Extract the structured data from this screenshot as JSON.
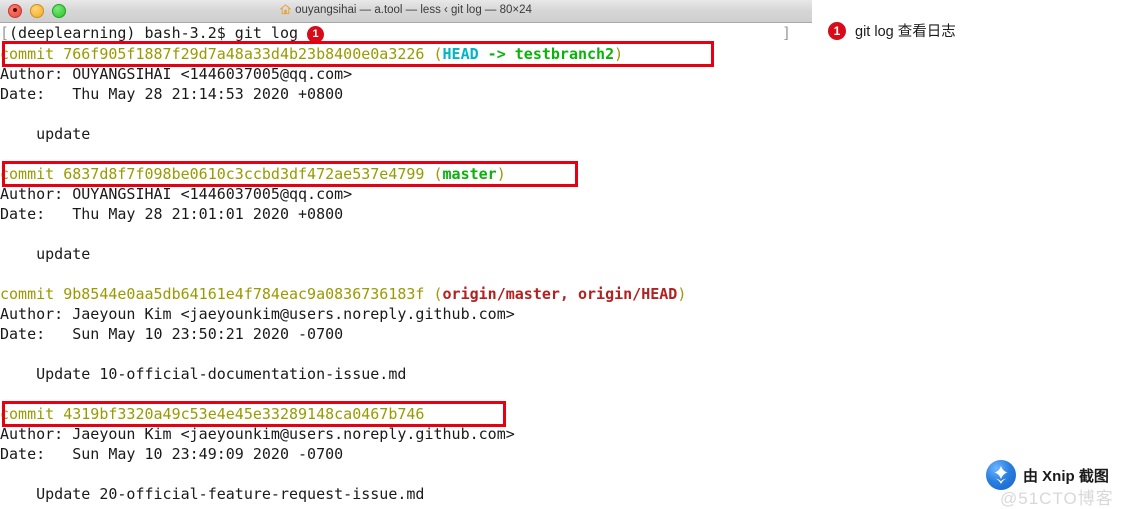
{
  "window": {
    "title": "ouyangsihai — a.tool — less ‹ git log — 80×24",
    "home_icon": "home-icon",
    "controls": {
      "close": "close",
      "minimize": "minimize",
      "maximize": "maximize"
    }
  },
  "terminal": {
    "prompt": {
      "lead_bracket": "[",
      "text": "(deeplearning) bash-3.2$ git log ",
      "badge": "1",
      "trailing_bracket": "]"
    },
    "commits": [
      {
        "keyword": "commit ",
        "hash": "766f905f1887f29d7a48a33d4b23b8400e0a3226",
        "refs_open": " (",
        "ref_head": "HEAD",
        "ref_arrow": " -> ",
        "ref_branch": "testbranch2",
        "refs_close": ")",
        "author": "Author: OUYANGSIHAI <1446037005@qq.com>",
        "date": "Date:   Thu May 28 21:14:53 2020 +0800",
        "message": "    update",
        "boxed": true
      },
      {
        "keyword": "commit ",
        "hash": "6837d8f7f098be0610c3ccbd3df472ae537e4799",
        "refs_open": " (",
        "ref_branch": "master",
        "refs_close": ")",
        "author": "Author: OUYANGSIHAI <1446037005@qq.com>",
        "date": "Date:   Thu May 28 21:01:01 2020 +0800",
        "message": "    update",
        "boxed": true
      },
      {
        "keyword": "commit ",
        "hash": "9b8544e0aa5db64161e4f784eac9a0836736183f",
        "refs_open": " (",
        "ref_remote": "origin/master, origin/HEAD",
        "refs_close": ")",
        "author": "Author: Jaeyoun Kim <jaeyounkim@users.noreply.github.com>",
        "date": "Date:   Sun May 10 23:50:21 2020 -0700",
        "message": "    Update 10-official-documentation-issue.md",
        "boxed": false
      },
      {
        "keyword": "commit ",
        "hash": "4319bf3320a49c53e4e45e33289148ca0467b746",
        "author": "Author: Jaeyoun Kim <jaeyounkim@users.noreply.github.com>",
        "date": "Date:   Sun May 10 23:49:09 2020 -0700",
        "message": "    Update 20-official-feature-request-issue.md",
        "boxed": true
      }
    ]
  },
  "annotation": {
    "badge": "1",
    "text": "git log 查看日志"
  },
  "watermark": {
    "xnip_text": "由 Xnip 截图",
    "cto_text": "@51CTO博客"
  },
  "colors": {
    "annotation_red": "#e60012",
    "badge_red": "#d80c18",
    "commit_yellow": "#9a9a00",
    "ref_cyan": "#00b6c4",
    "ref_green": "#0ab20a",
    "ref_darkred": "#b32020"
  }
}
